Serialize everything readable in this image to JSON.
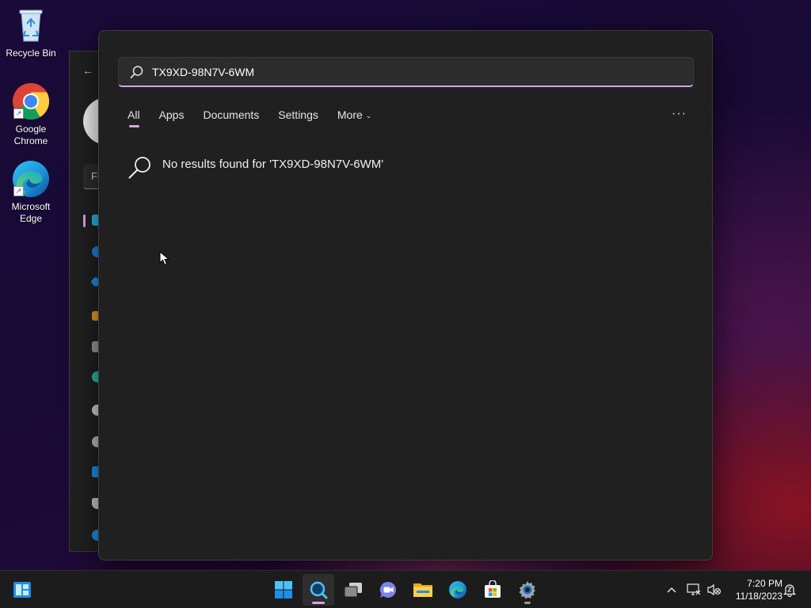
{
  "desktop": {
    "icons": [
      {
        "label": "Recycle Bin"
      },
      {
        "label": "Google Chrome"
      },
      {
        "label": "Microsoft Edge"
      }
    ]
  },
  "settings_window": {
    "find_placeholder": "Fi"
  },
  "search": {
    "query": "TX9XD-98N7V-6WM",
    "tabs": [
      {
        "label": "All",
        "active": true
      },
      {
        "label": "Apps"
      },
      {
        "label": "Documents"
      },
      {
        "label": "Settings"
      },
      {
        "label": "More"
      }
    ],
    "more_options": "···",
    "no_results_message": "No results found for 'TX9XD-98N7V-6WM'"
  },
  "taskbar": {
    "items": [
      "start-icon",
      "search-icon",
      "task-view-icon",
      "teams-chat-icon",
      "file-explorer-icon",
      "edge-icon",
      "store-icon",
      "settings-icon"
    ],
    "clock": {
      "time": "7:20 PM",
      "date": "11/18/2023"
    }
  },
  "colors": {
    "accent": "#d6a4e8",
    "panel": "#202020",
    "taskbar": "#1c1c1c"
  }
}
